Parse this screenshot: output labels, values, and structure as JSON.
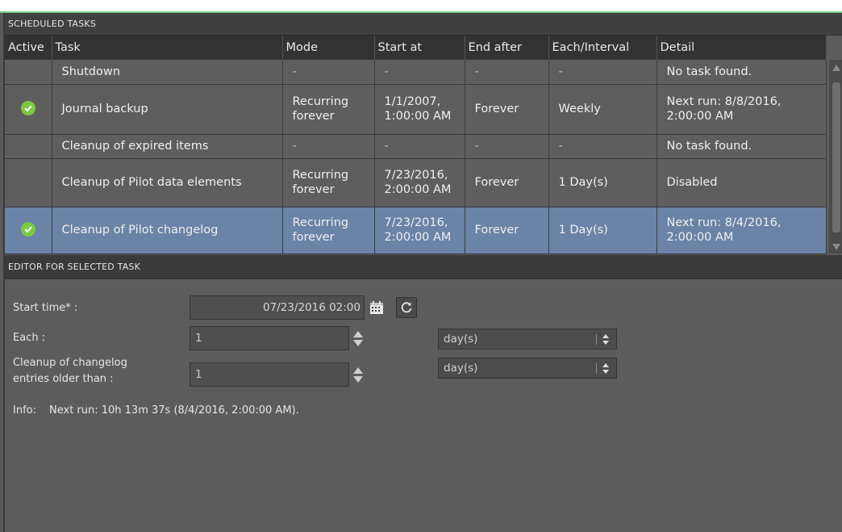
{
  "scheduled": {
    "header": "SCHEDULED TASKS",
    "columns": [
      "Active",
      "Task",
      "Mode",
      "Start at",
      "End after",
      "Each/Interval",
      "Detail"
    ],
    "rows": [
      {
        "active": false,
        "task": "Shutdown",
        "mode": "-",
        "start": "-",
        "end": "-",
        "interval": "-",
        "detail": "No task found."
      },
      {
        "active": true,
        "task": "Journal backup",
        "mode": "Recurring forever",
        "start": "1/1/2007, 1:00:00 AM",
        "end": "Forever",
        "interval": "Weekly",
        "detail": "Next run: 8/8/2016, 2:00:00 AM"
      },
      {
        "active": false,
        "task": "Cleanup of expired items",
        "mode": "-",
        "start": "-",
        "end": "-",
        "interval": "-",
        "detail": "No task found."
      },
      {
        "active": false,
        "task": "Cleanup of Pilot data elements",
        "mode": "Recurring forever",
        "start": "7/23/2016, 2:00:00 AM",
        "end": "Forever",
        "interval": "1 Day(s)",
        "detail": "Disabled"
      },
      {
        "active": true,
        "task": "Cleanup of Pilot changelog",
        "mode": "Recurring forever",
        "start": "7/23/2016, 2:00:00 AM",
        "end": "Forever",
        "interval": "1 Day(s)",
        "detail": "Next run: 8/4/2016, 2:00:00 AM"
      }
    ],
    "selected_row": 4
  },
  "editor": {
    "header": "EDITOR FOR SELECTED TASK",
    "start_time_label": "Start time* :",
    "start_time_value": "07/23/2016 02:00",
    "each_label": "Each :",
    "each_value": "1",
    "each_unit": "day(s)",
    "cleanup_label_1": "Cleanup of changelog",
    "cleanup_label_2": "entries older than :",
    "cleanup_value": "1",
    "cleanup_unit": "day(s)",
    "info_label": "Info:",
    "info_text": "Next run: 10h 13m 37s (8/4/2016, 2:00:00 AM)."
  },
  "icons": {
    "calendar": "calendar-icon",
    "refresh": "refresh-icon",
    "check": "check-circle-icon"
  },
  "colors": {
    "selected_row": "#6a83a7",
    "active_check": "#7ac943",
    "header_bg": "#404040"
  }
}
